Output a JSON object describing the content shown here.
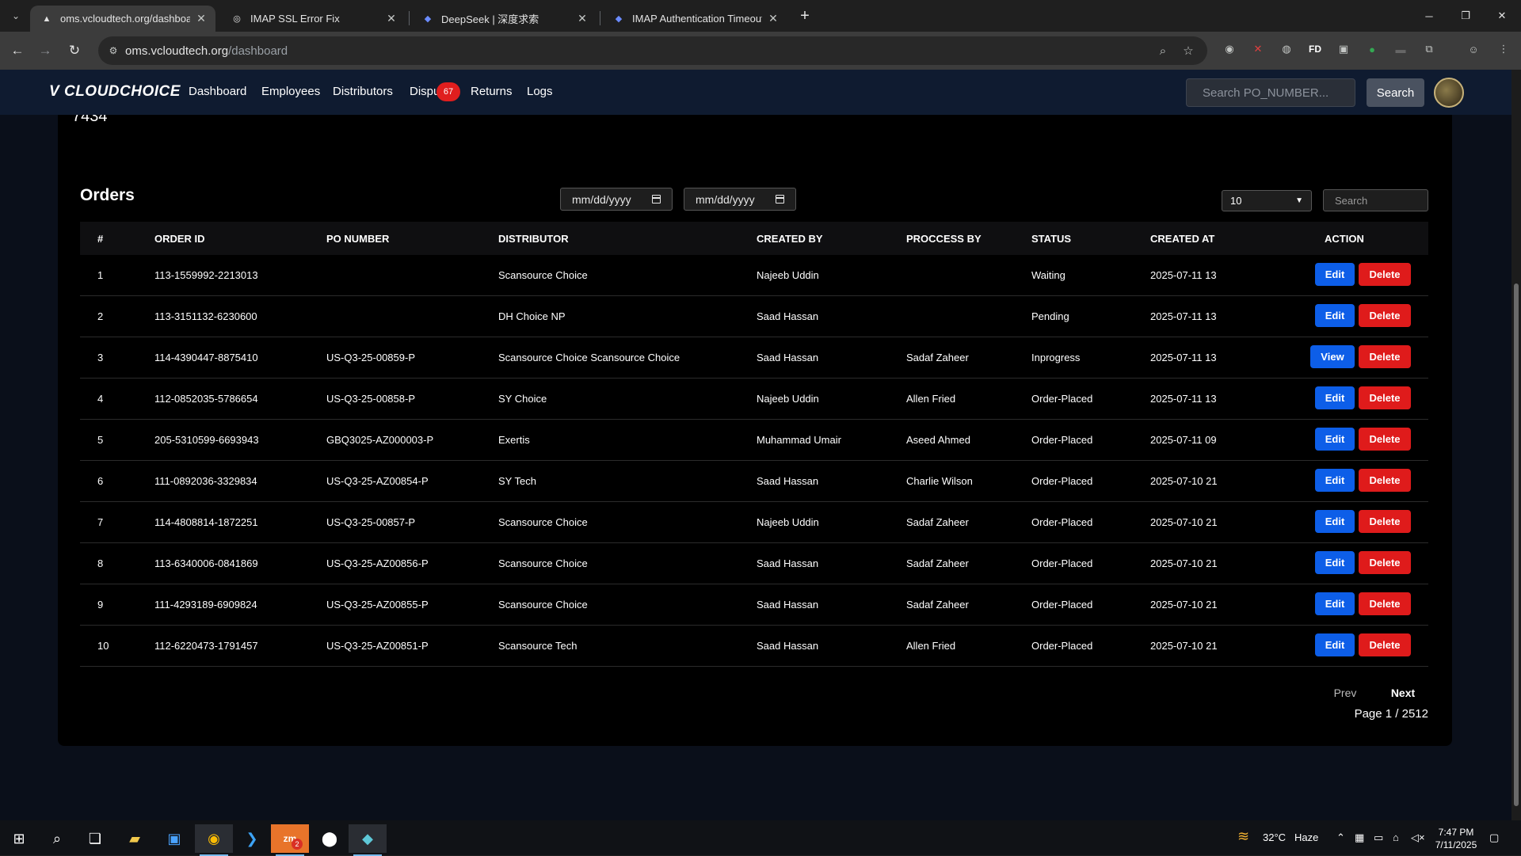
{
  "browser": {
    "tabs": [
      {
        "title": "oms.vcloudtech.org/dashboard",
        "active": true
      },
      {
        "title": "IMAP SSL Error Fix",
        "active": false
      },
      {
        "title": "DeepSeek | 深度求索",
        "active": false
      },
      {
        "title": "IMAP Authentication Timeout E",
        "active": false
      }
    ],
    "url_host": "oms.vcloudtech.org",
    "url_path": "/dashboard"
  },
  "app": {
    "logo": "CLOUDCHOICE",
    "nav": [
      "Dashboard",
      "Employees",
      "Distributors",
      "Dispu",
      "Returns",
      "Logs"
    ],
    "disputes_badge": "67",
    "search_placeholder": "Search PO_NUMBER...",
    "search_button": "Search"
  },
  "top_card_value": "7434",
  "orders": {
    "title": "Orders",
    "date_from_placeholder": "mm/dd/yyyy",
    "date_to_placeholder": "mm/dd/yyyy",
    "per_page": "10",
    "search_placeholder": "Search",
    "columns": [
      "#",
      "ORDER ID",
      "PO NUMBER",
      "DISTRIBUTOR",
      "CREATED BY",
      "PROCCESS BY",
      "STATUS",
      "CREATED AT",
      "ACTION"
    ],
    "rows": [
      {
        "n": "1",
        "order_id": "113-1559992-2213013",
        "po": "",
        "distributor": "Scansource Choice",
        "created_by": "Najeeb Uddin",
        "process_by": "",
        "status": "Waiting",
        "created_at": "2025-07-11 13",
        "primary": "Edit"
      },
      {
        "n": "2",
        "order_id": "113-3151132-6230600",
        "po": "",
        "distributor": "DH Choice NP",
        "created_by": "Saad Hassan",
        "process_by": "",
        "status": "Pending",
        "created_at": "2025-07-11 13",
        "primary": "Edit"
      },
      {
        "n": "3",
        "order_id": "114-4390447-8875410",
        "po": "US-Q3-25-00859-P",
        "distributor": "Scansource Choice Scansource Choice",
        "created_by": "Saad Hassan",
        "process_by": "Sadaf Zaheer",
        "status": "Inprogress",
        "created_at": "2025-07-11 13",
        "primary": "View"
      },
      {
        "n": "4",
        "order_id": "112-0852035-5786654",
        "po": "US-Q3-25-00858-P",
        "distributor": "SY Choice",
        "created_by": "Najeeb Uddin",
        "process_by": "Allen Fried",
        "status": "Order-Placed",
        "created_at": "2025-07-11 13",
        "primary": "Edit"
      },
      {
        "n": "5",
        "order_id": "205-5310599-6693943",
        "po": "GBQ3025-AZ000003-P",
        "distributor": "Exertis",
        "created_by": "Muhammad Umair",
        "process_by": "Aseed Ahmed",
        "status": "Order-Placed",
        "created_at": "2025-07-11 09",
        "primary": "Edit"
      },
      {
        "n": "6",
        "order_id": "111-0892036-3329834",
        "po": "US-Q3-25-AZ00854-P",
        "distributor": "SY Tech",
        "created_by": "Saad Hassan",
        "process_by": "Charlie Wilson",
        "status": "Order-Placed",
        "created_at": "2025-07-10 21",
        "primary": "Edit"
      },
      {
        "n": "7",
        "order_id": "114-4808814-1872251",
        "po": "US-Q3-25-00857-P",
        "distributor": "Scansource Choice",
        "created_by": "Najeeb Uddin",
        "process_by": "Sadaf Zaheer",
        "status": "Order-Placed",
        "created_at": "2025-07-10 21",
        "primary": "Edit"
      },
      {
        "n": "8",
        "order_id": "113-6340006-0841869",
        "po": "US-Q3-25-AZ00856-P",
        "distributor": "Scansource Choice",
        "created_by": "Saad Hassan",
        "process_by": "Sadaf Zaheer",
        "status": "Order-Placed",
        "created_at": "2025-07-10 21",
        "primary": "Edit"
      },
      {
        "n": "9",
        "order_id": "111-4293189-6909824",
        "po": "US-Q3-25-AZ00855-P",
        "distributor": "Scansource Choice",
        "created_by": "Saad Hassan",
        "process_by": "Sadaf Zaheer",
        "status": "Order-Placed",
        "created_at": "2025-07-10 21",
        "primary": "Edit"
      },
      {
        "n": "10",
        "order_id": "112-6220473-1791457",
        "po": "US-Q3-25-AZ00851-P",
        "distributor": "Scansource Tech",
        "created_by": "Saad Hassan",
        "process_by": "Allen Fried",
        "status": "Order-Placed",
        "created_at": "2025-07-10 21",
        "primary": "Edit"
      }
    ],
    "delete_label": "Delete",
    "prev_label": "Prev",
    "next_label": "Next",
    "page_info": "Page 1 / 2512"
  },
  "taskbar": {
    "weather": "32°C",
    "weather_desc": "Haze",
    "time": "7:47 PM",
    "date": "7/11/2025",
    "zoom_badge": "2"
  }
}
